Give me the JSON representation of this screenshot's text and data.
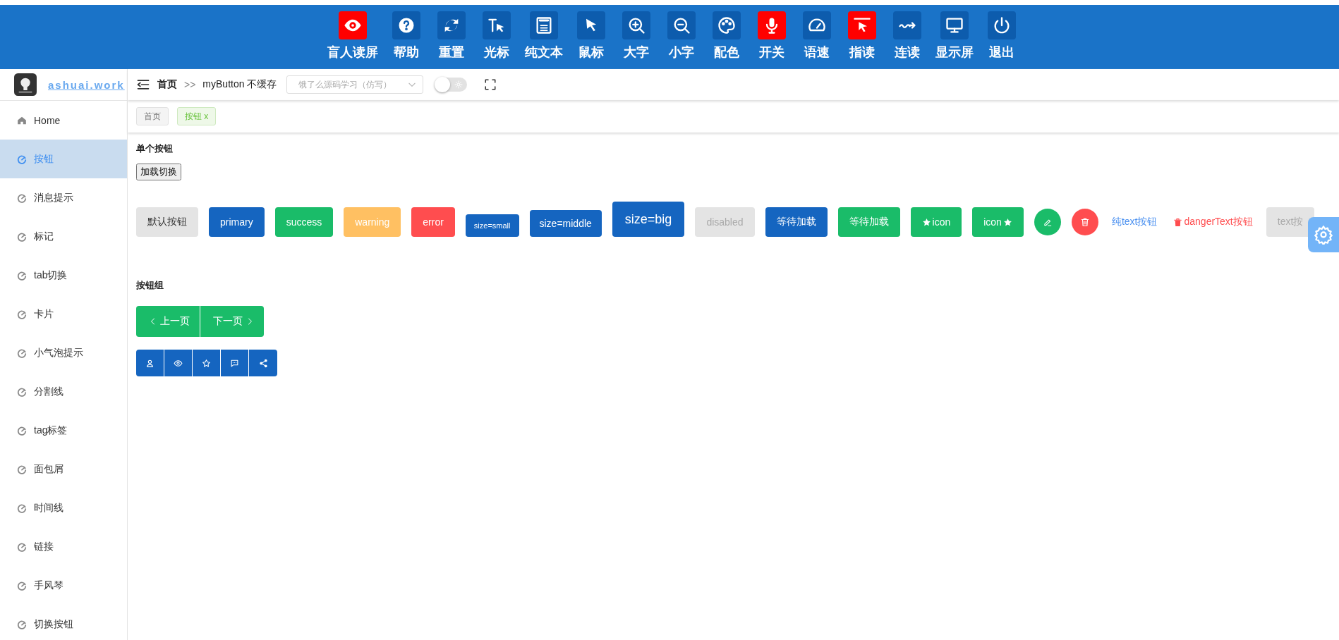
{
  "toolbar": [
    {
      "label": "盲人读屏",
      "on": true
    },
    {
      "label": "帮助",
      "on": false
    },
    {
      "label": "重置",
      "on": false
    },
    {
      "label": "光标",
      "on": false
    },
    {
      "label": "纯文本",
      "on": false
    },
    {
      "label": "鼠标",
      "on": false
    },
    {
      "label": "大字",
      "on": false
    },
    {
      "label": "小字",
      "on": false
    },
    {
      "label": "配色",
      "on": false
    },
    {
      "label": "开关",
      "on": true
    },
    {
      "label": "语速",
      "on": false
    },
    {
      "label": "指读",
      "on": true
    },
    {
      "label": "连读",
      "on": false
    },
    {
      "label": "显示屏",
      "on": false
    },
    {
      "label": "退出",
      "on": false
    }
  ],
  "logo": {
    "text": "ashuai.work"
  },
  "sidebar": {
    "items": [
      {
        "label": "Home",
        "kind": "home",
        "selected": false
      },
      {
        "label": "按钮",
        "kind": "page",
        "selected": true
      },
      {
        "label": "消息提示",
        "kind": "page",
        "selected": false
      },
      {
        "label": "标记",
        "kind": "page",
        "selected": false
      },
      {
        "label": "tab切换",
        "kind": "page",
        "selected": false
      },
      {
        "label": "卡片",
        "kind": "page",
        "selected": false
      },
      {
        "label": "小气泡提示",
        "kind": "page",
        "selected": false
      },
      {
        "label": "分割线",
        "kind": "page",
        "selected": false
      },
      {
        "label": "tag标签",
        "kind": "page",
        "selected": false
      },
      {
        "label": "面包屑",
        "kind": "page",
        "selected": false
      },
      {
        "label": "时间线",
        "kind": "page",
        "selected": false
      },
      {
        "label": "链接",
        "kind": "page",
        "selected": false
      },
      {
        "label": "手风琴",
        "kind": "page",
        "selected": false
      },
      {
        "label": "切换按钮",
        "kind": "page",
        "selected": false
      }
    ]
  },
  "header": {
    "breadcrumb": [
      "首页",
      ">>",
      "myButton 不缓存"
    ],
    "select": {
      "placeholder": "饿了么源码学习（仿写）"
    },
    "theme_switch": {
      "on": false
    }
  },
  "tabs": [
    {
      "label": "首页",
      "selected": false
    },
    {
      "label": "按钮",
      "close": "x",
      "selected": true
    }
  ],
  "single": {
    "title": "单个按钮",
    "toggle_button": "加载切换",
    "buttons": [
      {
        "kind": "default",
        "label": "默认按钮",
        "disabled": false
      },
      {
        "kind": "primary",
        "label": "primary",
        "disabled": false
      },
      {
        "kind": "success",
        "label": "success",
        "disabled": false
      },
      {
        "kind": "warning",
        "label": "warning",
        "disabled": false
      },
      {
        "kind": "error",
        "label": "error",
        "disabled": false
      },
      {
        "kind": "small",
        "label": "size=small",
        "disabled": false
      },
      {
        "kind": "middle",
        "label": "size=middle",
        "disabled": false
      },
      {
        "kind": "big",
        "label": "size=big",
        "disabled": false
      },
      {
        "kind": "default",
        "label": "disabled",
        "disabled": true
      },
      {
        "kind": "primary",
        "label": "等待加载",
        "disabled": false
      },
      {
        "kind": "success",
        "label": "等待加载",
        "disabled": false
      },
      {
        "kind": "starleft",
        "label": "icon",
        "disabled": false
      },
      {
        "kind": "starright",
        "label": "icon",
        "disabled": false
      },
      {
        "kind": "edit",
        "disabled": false
      },
      {
        "kind": "delete",
        "disabled": false
      },
      {
        "kind": "text",
        "label": "纯text按钮",
        "disabled": false
      },
      {
        "kind": "danger",
        "label": "dangerText按钮",
        "disabled": false
      },
      {
        "kind": "default",
        "label": "text按",
        "disabled": true
      }
    ]
  },
  "group": {
    "title": "按钮组",
    "pager": [
      {
        "label": "上一页",
        "kind": "prev"
      },
      {
        "label": "下一页",
        "kind": "next"
      }
    ]
  }
}
